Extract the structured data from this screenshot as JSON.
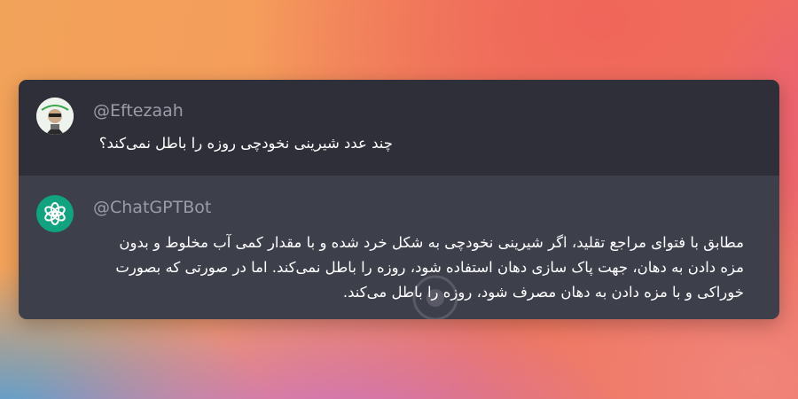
{
  "thread": {
    "question": {
      "author": "@Eftezaah",
      "text": "چند عدد شیرینی نخودچی روزه را باطل نمی‌کند؟",
      "avatar_icon": "user-avatar-photo"
    },
    "answer": {
      "author": "@ChatGPTBot",
      "text": "مطابق با فتوای مراجع تقلید، اگر شیرینی نخودچی به شکل خرد شده و با مقدار کمی آب مخلوط و بدون مزه دادن به دهان، جهت پاک سازی دهان استفاده شود، روزه را باطل نمی‌کند. اما در صورتی که بصورت خوراکی و با مزه دادن به دهان مصرف شود، روزه را باطل می‌کند.",
      "avatar_icon": "openai-logo-icon",
      "avatar_color": "#10a37f"
    }
  },
  "theme": {
    "question_bg": "#2e2f39",
    "answer_bg": "#3d3f4b",
    "handle_color": "#9b9ca8",
    "text_color": "#ffffff"
  }
}
